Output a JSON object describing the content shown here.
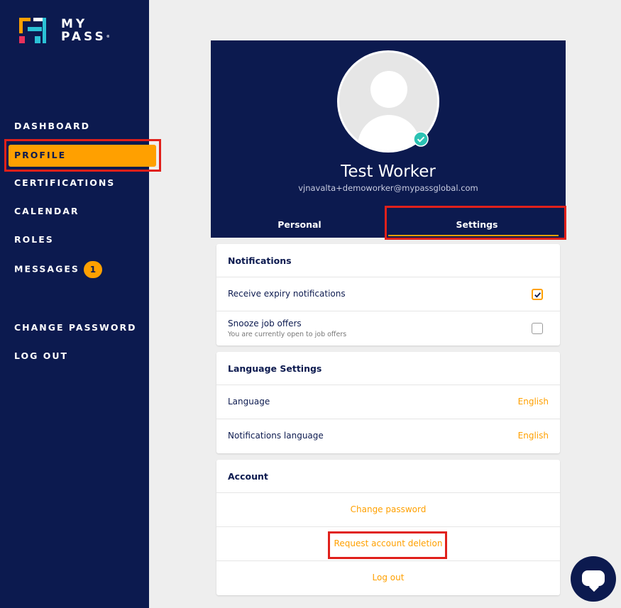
{
  "brand": {
    "line1": "MY",
    "line2": "PASS",
    "trademark": "®"
  },
  "sidebar": {
    "items": [
      {
        "label": "DASHBOARD"
      },
      {
        "label": "PROFILE"
      },
      {
        "label": "CERTIFICATIONS"
      },
      {
        "label": "CALENDAR"
      },
      {
        "label": "ROLES"
      },
      {
        "label": "MESSAGES",
        "badge": "1"
      },
      {
        "label": "CHANGE PASSWORD"
      },
      {
        "label": "LOG OUT"
      }
    ]
  },
  "profile": {
    "name": "Test Worker",
    "email": "vjnavalta+demoworker@mypassglobal.com",
    "tabs": [
      {
        "label": "Personal"
      },
      {
        "label": "Settings"
      }
    ]
  },
  "notifications": {
    "title": "Notifications",
    "expiry_label": "Receive expiry notifications",
    "expiry_checked": true,
    "snooze_label": "Snooze job offers",
    "snooze_sub": "You are currently open to job offers",
    "snooze_checked": false
  },
  "language": {
    "title": "Language Settings",
    "language_label": "Language",
    "language_value": "English",
    "notif_language_label": "Notifications language",
    "notif_language_value": "English"
  },
  "account": {
    "title": "Account",
    "change_password": "Change password",
    "request_deletion": "Request account deletion",
    "log_out": "Log out"
  },
  "colors": {
    "navy": "#0c1a4f",
    "accent": "#ffa000",
    "highlight": "#e0201b",
    "verified": "#2bc2b3"
  }
}
